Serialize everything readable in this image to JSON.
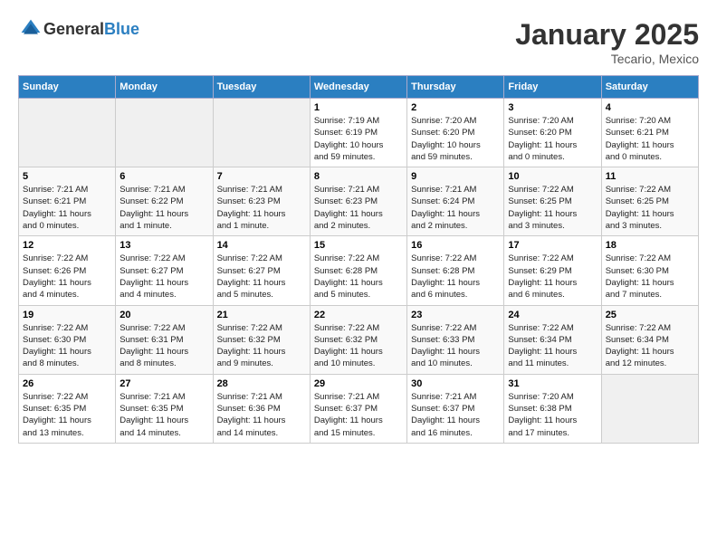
{
  "header": {
    "logo_general": "General",
    "logo_blue": "Blue",
    "month_title": "January 2025",
    "subtitle": "Tecario, Mexico"
  },
  "days_of_week": [
    "Sunday",
    "Monday",
    "Tuesday",
    "Wednesday",
    "Thursday",
    "Friday",
    "Saturday"
  ],
  "weeks": [
    [
      {
        "day": "",
        "info": ""
      },
      {
        "day": "",
        "info": ""
      },
      {
        "day": "",
        "info": ""
      },
      {
        "day": "1",
        "info": "Sunrise: 7:19 AM\nSunset: 6:19 PM\nDaylight: 10 hours\nand 59 minutes."
      },
      {
        "day": "2",
        "info": "Sunrise: 7:20 AM\nSunset: 6:20 PM\nDaylight: 10 hours\nand 59 minutes."
      },
      {
        "day": "3",
        "info": "Sunrise: 7:20 AM\nSunset: 6:20 PM\nDaylight: 11 hours\nand 0 minutes."
      },
      {
        "day": "4",
        "info": "Sunrise: 7:20 AM\nSunset: 6:21 PM\nDaylight: 11 hours\nand 0 minutes."
      }
    ],
    [
      {
        "day": "5",
        "info": "Sunrise: 7:21 AM\nSunset: 6:21 PM\nDaylight: 11 hours\nand 0 minutes."
      },
      {
        "day": "6",
        "info": "Sunrise: 7:21 AM\nSunset: 6:22 PM\nDaylight: 11 hours\nand 1 minute."
      },
      {
        "day": "7",
        "info": "Sunrise: 7:21 AM\nSunset: 6:23 PM\nDaylight: 11 hours\nand 1 minute."
      },
      {
        "day": "8",
        "info": "Sunrise: 7:21 AM\nSunset: 6:23 PM\nDaylight: 11 hours\nand 2 minutes."
      },
      {
        "day": "9",
        "info": "Sunrise: 7:21 AM\nSunset: 6:24 PM\nDaylight: 11 hours\nand 2 minutes."
      },
      {
        "day": "10",
        "info": "Sunrise: 7:22 AM\nSunset: 6:25 PM\nDaylight: 11 hours\nand 3 minutes."
      },
      {
        "day": "11",
        "info": "Sunrise: 7:22 AM\nSunset: 6:25 PM\nDaylight: 11 hours\nand 3 minutes."
      }
    ],
    [
      {
        "day": "12",
        "info": "Sunrise: 7:22 AM\nSunset: 6:26 PM\nDaylight: 11 hours\nand 4 minutes."
      },
      {
        "day": "13",
        "info": "Sunrise: 7:22 AM\nSunset: 6:27 PM\nDaylight: 11 hours\nand 4 minutes."
      },
      {
        "day": "14",
        "info": "Sunrise: 7:22 AM\nSunset: 6:27 PM\nDaylight: 11 hours\nand 5 minutes."
      },
      {
        "day": "15",
        "info": "Sunrise: 7:22 AM\nSunset: 6:28 PM\nDaylight: 11 hours\nand 5 minutes."
      },
      {
        "day": "16",
        "info": "Sunrise: 7:22 AM\nSunset: 6:28 PM\nDaylight: 11 hours\nand 6 minutes."
      },
      {
        "day": "17",
        "info": "Sunrise: 7:22 AM\nSunset: 6:29 PM\nDaylight: 11 hours\nand 6 minutes."
      },
      {
        "day": "18",
        "info": "Sunrise: 7:22 AM\nSunset: 6:30 PM\nDaylight: 11 hours\nand 7 minutes."
      }
    ],
    [
      {
        "day": "19",
        "info": "Sunrise: 7:22 AM\nSunset: 6:30 PM\nDaylight: 11 hours\nand 8 minutes."
      },
      {
        "day": "20",
        "info": "Sunrise: 7:22 AM\nSunset: 6:31 PM\nDaylight: 11 hours\nand 8 minutes."
      },
      {
        "day": "21",
        "info": "Sunrise: 7:22 AM\nSunset: 6:32 PM\nDaylight: 11 hours\nand 9 minutes."
      },
      {
        "day": "22",
        "info": "Sunrise: 7:22 AM\nSunset: 6:32 PM\nDaylight: 11 hours\nand 10 minutes."
      },
      {
        "day": "23",
        "info": "Sunrise: 7:22 AM\nSunset: 6:33 PM\nDaylight: 11 hours\nand 10 minutes."
      },
      {
        "day": "24",
        "info": "Sunrise: 7:22 AM\nSunset: 6:34 PM\nDaylight: 11 hours\nand 11 minutes."
      },
      {
        "day": "25",
        "info": "Sunrise: 7:22 AM\nSunset: 6:34 PM\nDaylight: 11 hours\nand 12 minutes."
      }
    ],
    [
      {
        "day": "26",
        "info": "Sunrise: 7:22 AM\nSunset: 6:35 PM\nDaylight: 11 hours\nand 13 minutes."
      },
      {
        "day": "27",
        "info": "Sunrise: 7:21 AM\nSunset: 6:35 PM\nDaylight: 11 hours\nand 14 minutes."
      },
      {
        "day": "28",
        "info": "Sunrise: 7:21 AM\nSunset: 6:36 PM\nDaylight: 11 hours\nand 14 minutes."
      },
      {
        "day": "29",
        "info": "Sunrise: 7:21 AM\nSunset: 6:37 PM\nDaylight: 11 hours\nand 15 minutes."
      },
      {
        "day": "30",
        "info": "Sunrise: 7:21 AM\nSunset: 6:37 PM\nDaylight: 11 hours\nand 16 minutes."
      },
      {
        "day": "31",
        "info": "Sunrise: 7:20 AM\nSunset: 6:38 PM\nDaylight: 11 hours\nand 17 minutes."
      },
      {
        "day": "",
        "info": ""
      }
    ]
  ]
}
